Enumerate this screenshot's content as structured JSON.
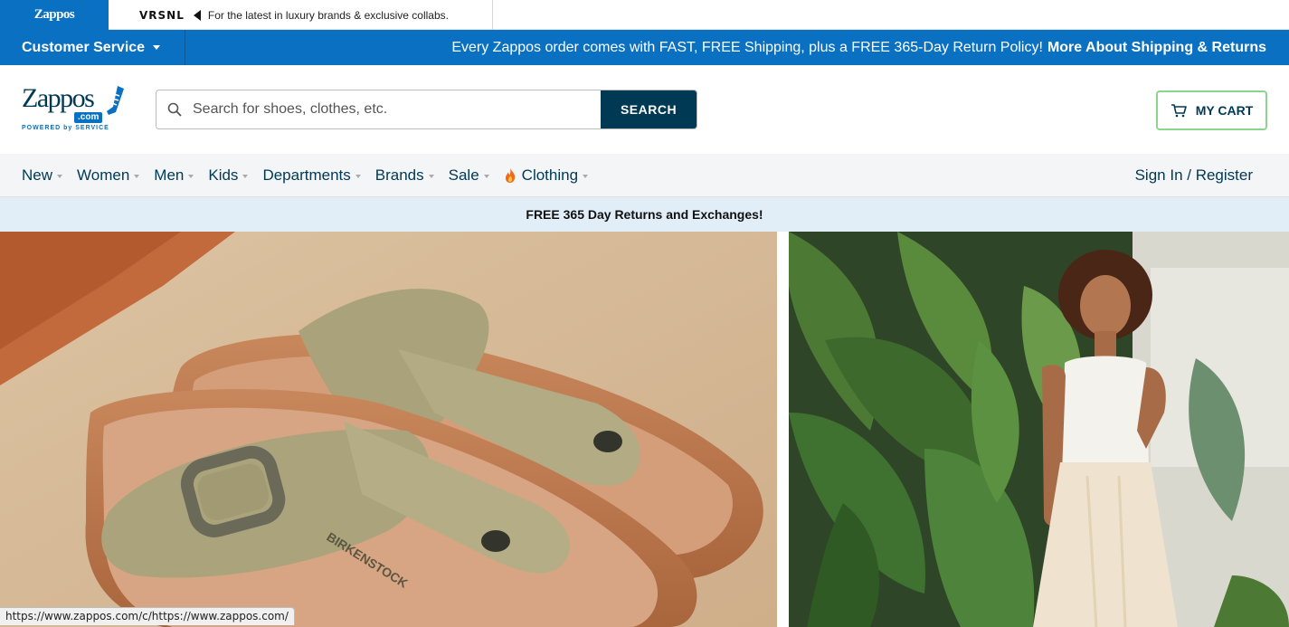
{
  "top_strip": {
    "tabs": [
      {
        "name": "Zappos"
      },
      {
        "name": "VRSNL",
        "text": "For the latest in luxury brands & exclusive collabs."
      }
    ]
  },
  "bluebar": {
    "customer_service": "Customer Service",
    "shipping_text": "Every Zappos order comes with FAST, FREE Shipping, plus a FREE 365-Day Return Policy!",
    "shipping_link": "More About Shipping & Returns"
  },
  "header": {
    "logo": {
      "word": "Zappos",
      "com": ".com",
      "tagline": "POWERED by SERVICE"
    },
    "search": {
      "placeholder": "Search for shoes, clothes, etc.",
      "button": "SEARCH"
    },
    "cart": {
      "label": "MY CART"
    }
  },
  "nav": {
    "items": [
      {
        "label": "New"
      },
      {
        "label": "Women"
      },
      {
        "label": "Men"
      },
      {
        "label": "Kids"
      },
      {
        "label": "Departments"
      },
      {
        "label": "Brands"
      },
      {
        "label": "Sale"
      },
      {
        "label": "Clothing",
        "icon": "fire-icon"
      }
    ],
    "signin": "Sign In / Register"
  },
  "promo": {
    "text": "FREE 365 Day Returns and Exchanges!"
  },
  "hero": {
    "left": {
      "alt": "Sandals product image",
      "brand_on_footbed": "BIRKENSTOCK"
    },
    "right": {
      "alt": "Woman in white top among tropical plants"
    }
  },
  "status_bar": {
    "url": "https://www.zappos.com/c/https://www.zappos.com/"
  },
  "colors": {
    "brand_blue": "#0a70c2",
    "navy": "#003953",
    "cart_border": "#8cd58c",
    "promo_bg": "#e1eef8"
  }
}
